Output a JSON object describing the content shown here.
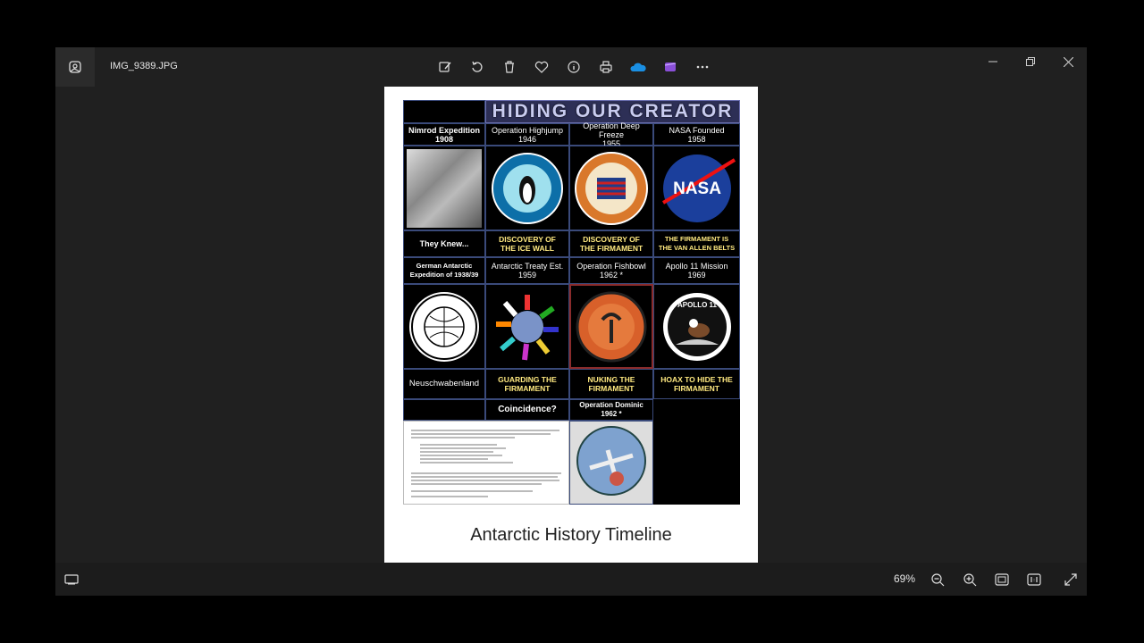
{
  "window": {
    "filename": "IMG_9389.JPG",
    "toolbar_icons": [
      "edit-image-icon",
      "rotate-icon",
      "delete-icon",
      "favorite-icon",
      "info-icon",
      "print-icon",
      "onedrive-icon",
      "clipchamp-icon",
      "more-icon"
    ],
    "zoom": "69%"
  },
  "poster": {
    "title": "HIDING OUR CREATOR",
    "row1": [
      {
        "label": "Nimrod Expedition\n1908"
      },
      {
        "label": "Operation Highjump\n1946"
      },
      {
        "label": "Operation Deep Freeze\n1955"
      },
      {
        "label": "NASA Founded\n1958"
      }
    ],
    "row1_captions": [
      "They Knew...",
      "DISCOVERY OF\nTHE ICE WALL",
      "DISCOVERY OF\nTHE FIRMAMENT",
      "THE FIRMAMENT IS\nTHE VAN ALLEN BELTS"
    ],
    "row2": [
      {
        "label": "German Antarctic\nExpedition of 1938/39"
      },
      {
        "label": "Antarctic Treaty Est.\n1959"
      },
      {
        "label": "Operation Fishbowl\n1962 *"
      },
      {
        "label": "Apollo 11 Mission\n1969"
      }
    ],
    "row2_captions": [
      "Neuschwabenland",
      "GUARDING THE\nFIRMAMENT",
      "NUKING THE\nFIRMAMENT",
      "HOAX TO HIDE THE\nFIRMAMENT"
    ],
    "coincidence": "Coincidence?",
    "dominic": "Operation Dominic\n1962 *",
    "nasa_logo": "NASA",
    "apollo_logo": "APOLLO 11"
  },
  "caption": "Antarctic History Timeline",
  "colors": {
    "accent_yellow": "#ffe980",
    "frame_blue": "#3a4a7a",
    "title_band": "#2d2f56"
  }
}
